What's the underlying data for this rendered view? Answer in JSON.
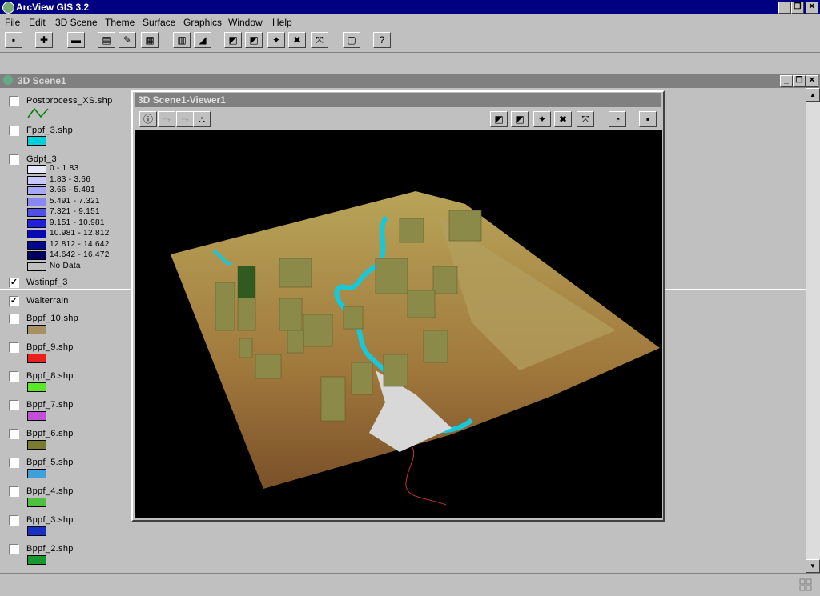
{
  "app": {
    "title": "ArcView GIS 3.2"
  },
  "menu": [
    "File",
    "Edit",
    "3D Scene",
    "Theme",
    "Surface",
    "Graphics",
    "Window",
    "Help"
  ],
  "window_buttons": {
    "minimize": "_",
    "restore": "❐",
    "close": "✕"
  },
  "toolbar": {
    "icons": [
      "save-icon",
      "add-theme-icon",
      "table-icon",
      "properties-icon",
      "pencil-icon",
      "scene-icon",
      "tile-icon",
      "edit-icon",
      "open-icon",
      "open-2-icon",
      "zoom-icon",
      "zoom-out-icon",
      "full-extent-icon",
      "layout-icon",
      "help-icon"
    ]
  },
  "scene_window": {
    "title": "3D Scene1"
  },
  "viewer": {
    "title": "3D Scene1-Viewer1"
  },
  "legend": {
    "layers": [
      {
        "name": "Postprocess_XS.shp",
        "checked": false,
        "color": "#008000"
      },
      {
        "name": "Fppf_3.shp",
        "checked": false,
        "color": "#00d0d8"
      },
      {
        "name": "Gdpf_3",
        "checked": false
      },
      {
        "name": "Wstinpf_3",
        "checked": true
      },
      {
        "name": "Walterrain",
        "checked": true
      },
      {
        "name": "Bppf_10.shp",
        "checked": false,
        "color": "#a89060"
      },
      {
        "name": "Bppf_9.shp",
        "checked": false,
        "color": "#e82020"
      },
      {
        "name": "Bppf_8.shp",
        "checked": false,
        "color": "#58e828"
      },
      {
        "name": "Bppf_7.shp",
        "checked": false,
        "color": "#c050d8"
      },
      {
        "name": "Bppf_6.shp",
        "checked": false,
        "color": "#787c30"
      },
      {
        "name": "Bppf_5.shp",
        "checked": false,
        "color": "#40a0d8"
      },
      {
        "name": "Bppf_4.shp",
        "checked": false,
        "color": "#50c040"
      },
      {
        "name": "Bppf_3.shp",
        "checked": false,
        "color": "#1830c8"
      },
      {
        "name": "Bppf_2.shp",
        "checked": false,
        "color": "#189830"
      }
    ],
    "gdpf_classes": [
      {
        "label": "0 - 1.83",
        "color": "#e8e8ff"
      },
      {
        "label": "1.83 - 3.66",
        "color": "#c8c8ff"
      },
      {
        "label": "3.66 - 5.491",
        "color": "#a8a8f8"
      },
      {
        "label": "5.491 - 7.321",
        "color": "#8888f0"
      },
      {
        "label": "7.321 - 9.151",
        "color": "#5050e8"
      },
      {
        "label": "9.151 - 10.981",
        "color": "#2020d8"
      },
      {
        "label": "10.981 - 12.812",
        "color": "#0808b0"
      },
      {
        "label": "12.812 - 14.642",
        "color": "#000890"
      },
      {
        "label": "14.642 - 16.472",
        "color": "#000060"
      },
      {
        "label": "No Data",
        "color": "#c0c0c0"
      }
    ]
  }
}
